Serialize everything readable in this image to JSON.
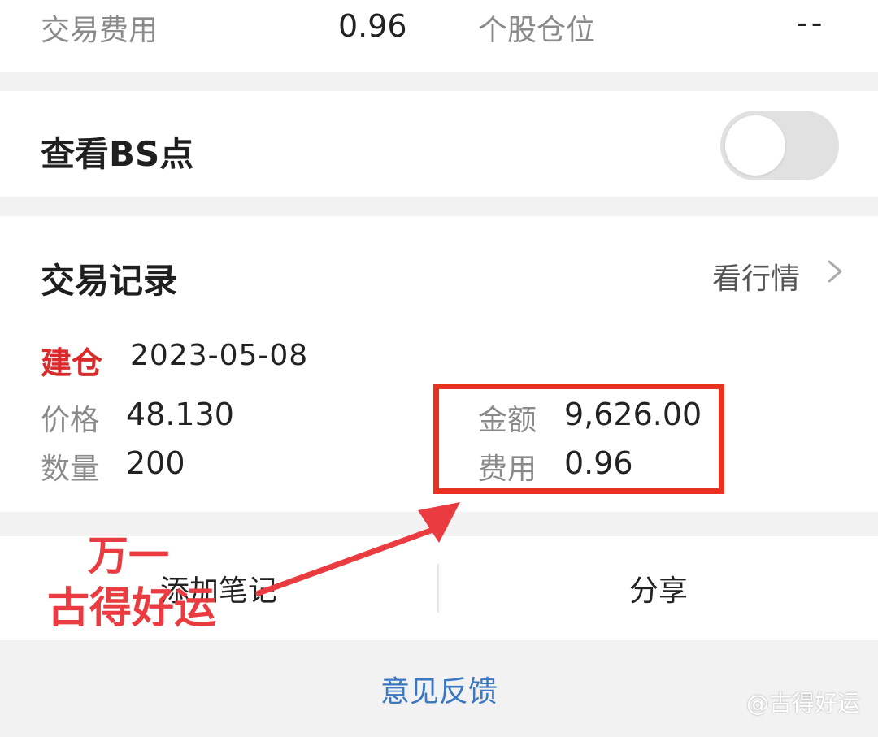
{
  "stats": {
    "fee_label": "交易费用",
    "fee_value": "0.96",
    "position_label": "个股仓位",
    "position_value": "--"
  },
  "bs_points": {
    "label": "查看BS点",
    "toggle_on": false
  },
  "trade_record": {
    "title": "交易记录",
    "market_link": "看行情",
    "entry": {
      "type": "建仓",
      "date": "2023-05-08",
      "price_label": "价格",
      "price_value": "48.130",
      "quantity_label": "数量",
      "quantity_value": "200",
      "amount_label": "金额",
      "amount_value": "9,626.00",
      "cost_label": "费用",
      "cost_value": "0.96"
    }
  },
  "actions": {
    "add_note": "添加笔记",
    "share": "分享"
  },
  "feedback": {
    "label": "意见反馈"
  },
  "annotation": {
    "line1": "万一",
    "line2": "古得好运"
  },
  "watermark": "@古得好运",
  "colors": {
    "accent_red": "#d92b2b",
    "annotation_red": "#ea3b40",
    "link_blue": "#3a78c2",
    "toggle_off": "#e1e1e1"
  }
}
